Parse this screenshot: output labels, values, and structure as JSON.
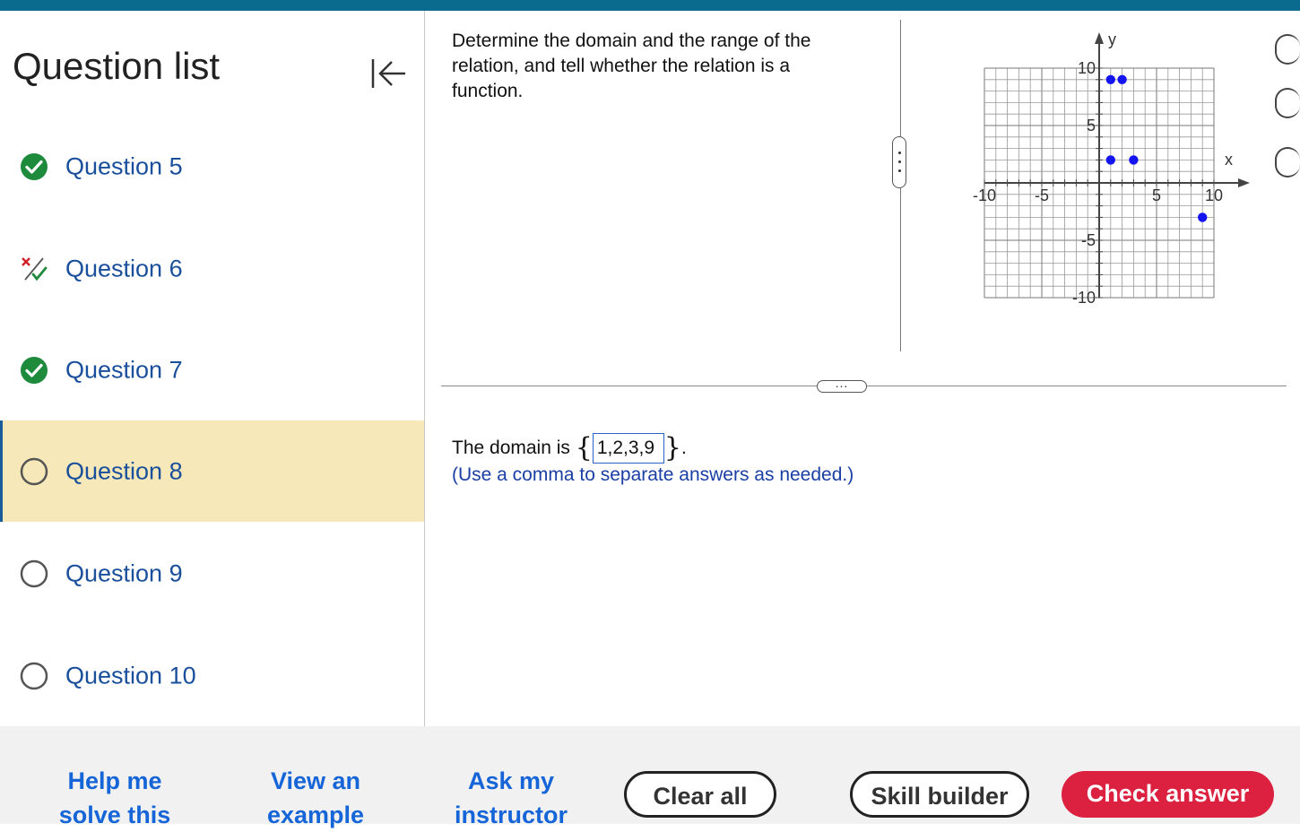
{
  "sidebar": {
    "title": "Question list",
    "questions": [
      {
        "label": "Question 5",
        "status": "correct"
      },
      {
        "label": "Question 6",
        "status": "partial"
      },
      {
        "label": "Question 7",
        "status": "correct"
      },
      {
        "label": "Question 8",
        "status": "current"
      },
      {
        "label": "Question 9",
        "status": "unanswered"
      },
      {
        "label": "Question 10",
        "status": "unanswered"
      }
    ]
  },
  "question": {
    "instructions": "Determine the domain and the range of the relation, and tell whether the relation is a function.",
    "graph": {
      "axis_labels": {
        "x": "x",
        "y": "y"
      },
      "x_ticks": [
        "-10",
        "-5",
        "5",
        "10"
      ],
      "y_ticks": [
        "10",
        "5",
        "-5",
        "-10"
      ],
      "range": [
        -10,
        10
      ],
      "points": [
        [
          1,
          2
        ],
        [
          1,
          9
        ],
        [
          2,
          9
        ],
        [
          3,
          2
        ],
        [
          9,
          -3
        ]
      ],
      "point_color": "#1414f0"
    },
    "answer_prefix": "The domain is",
    "answer_value": "1,2,3,9",
    "answer_suffix": ".",
    "hint": "(Use a comma to separate answers as needed.)"
  },
  "bottom": {
    "help_me": "Help me solve this",
    "view_example": "View an example",
    "ask_instructor": "Ask my instructor",
    "clear_all": "Clear all",
    "skill_builder": "Skill builder",
    "check_answer": "Check answer"
  },
  "colors": {
    "accent_bar": "#0b6b8e",
    "link_blue": "#1565d8",
    "check_answer_bg": "#dc2140",
    "selected_row_bg": "#f7e8b9",
    "correct_green": "#1e8a3c"
  }
}
